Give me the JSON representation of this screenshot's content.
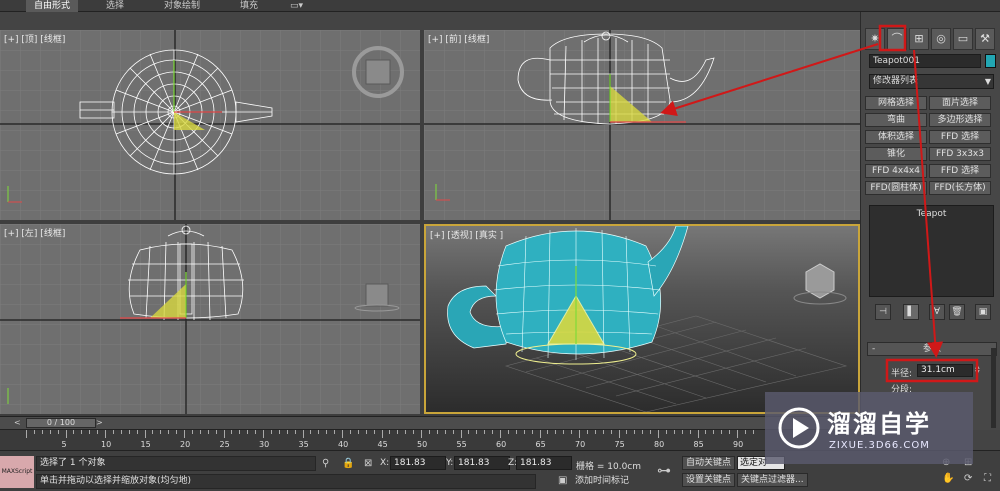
{
  "ribbon": {
    "tabs": [
      {
        "label": "自由形式",
        "active": true
      },
      {
        "label": "选择",
        "active": false
      },
      {
        "label": "对象绘制",
        "active": false
      },
      {
        "label": "填充",
        "active": false
      }
    ]
  },
  "viewports": {
    "top": {
      "label": "[+] [顶] [线框]"
    },
    "front": {
      "label": "[+] [前] [线框]"
    },
    "left": {
      "label": "[+] [左] [线框]"
    },
    "perspective": {
      "label": "[+] [透视] [真实 ]"
    }
  },
  "command_panel": {
    "tab_icons": [
      "sun-icon",
      "modify-icon",
      "hierarchy-icon",
      "motion-icon",
      "display-icon",
      "utilities-icon"
    ],
    "object_name": "Teapot001",
    "object_color": "#22a6b3",
    "modifier_list": "修改器列表",
    "modifier_buttons": [
      "网格选择",
      "面片选择",
      "弯曲",
      "多边形选择",
      "体积选择",
      "FFD 选择",
      "锥化",
      "FFD 3x3x3",
      "FFD 4x4x4",
      "FFD 选择",
      "FFD(圆柱体)",
      "FFD(长方体)"
    ],
    "stack_item": "Teapot",
    "params_title": "参数",
    "radius_label": "半径:",
    "radius_value": "31.1cm",
    "segments_label": "分段:"
  },
  "timeline": {
    "position": "0 / 100",
    "ticks": [
      "5",
      "10",
      "15",
      "20",
      "25",
      "30",
      "35",
      "40",
      "45",
      "50",
      "55",
      "60",
      "65",
      "70",
      "75",
      "80",
      "85",
      "90"
    ]
  },
  "status": {
    "maxscript": "MAXScript",
    "selected_msg": "选择了 1 个对象",
    "prompt_msg": "单击并拖动以选择并缩放对象(均匀地)",
    "x_label": "X:",
    "x_value": "181.83",
    "y_label": "Y:",
    "y_value": "181.83",
    "z_label": "Z:",
    "z_value": "181.83",
    "grid_label": "栅格 = 10.0cm",
    "add_time_tag": "添加时间标记",
    "auto_key": "自动关键点",
    "set_key": "设置关键点",
    "selected_dropdown": "选定对",
    "key_filters": "关键点过滤器..."
  },
  "watermark": {
    "title": "溜溜自学",
    "url": "ZIXUE.3D66.COM"
  },
  "colors": {
    "annotation_red": "#d01818",
    "teapot_teal": "#2fb0c0",
    "gizmo_yellow": "#e0e040",
    "viewport_bg": "#6f6f6f",
    "active_border": "#c9a53a"
  }
}
